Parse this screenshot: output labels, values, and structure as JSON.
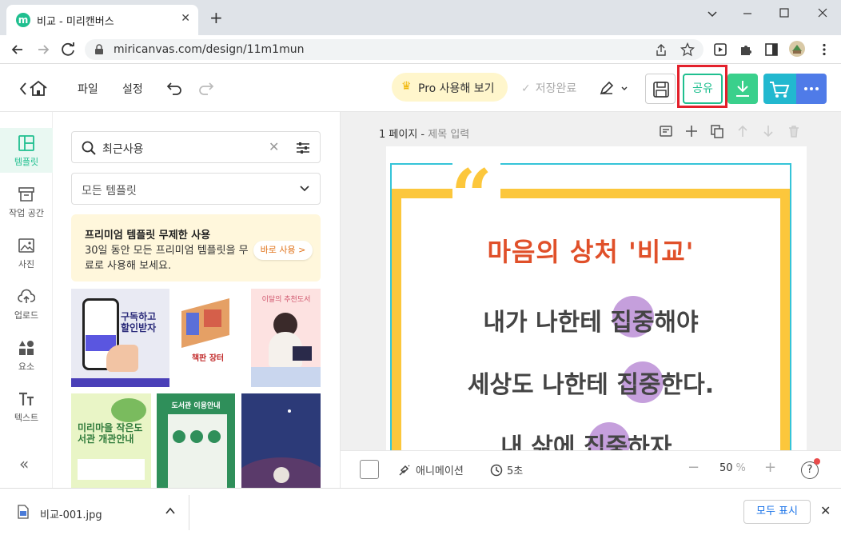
{
  "browser": {
    "tab_title": "비교 - 미리캔버스",
    "tab_favicon_letter": "m",
    "url": "miricanvas.com/design/11m1mun",
    "new_tab": "+",
    "tab_close": "✕"
  },
  "header": {
    "menu_file": "파일",
    "menu_settings": "설정",
    "pro_label": "Pro 사용해 보기",
    "saved_status": "저장완료",
    "share_label": "공유"
  },
  "leftnav": {
    "items": [
      {
        "label": "템플릿"
      },
      {
        "label": "작업 공간"
      },
      {
        "label": "사진"
      },
      {
        "label": "업로드"
      },
      {
        "label": "요소"
      },
      {
        "label": "텍스트"
      }
    ],
    "collapse": "«"
  },
  "panel": {
    "search_value": "최근사용",
    "category": "모든 템플릿",
    "promo_title": "프리미엄 템플릿 무제한 사용",
    "promo_desc": "30일 동안 모든 프리미엄 템플릿을 무료로 사용해 보세요.",
    "promo_button": "바로 사용 >",
    "thumb_texts": {
      "t1": "구독하고 할인받자",
      "t2": "책판 장터",
      "t3": "이달의 추천도서",
      "t4": "미리마을 작은도서관 개관안내",
      "t5": "도서관 이용안내"
    }
  },
  "canvas": {
    "page_label": "1 페이지",
    "page_title_placeholder": "제목 입력",
    "quote_mark": "“",
    "heading": "마음의 상처 '비교'",
    "lines": [
      "내가 나한테 집중해야",
      "세상도 나한테 집중한다.",
      "내 삶에 집중하자."
    ],
    "animation_label": "애니메이션",
    "duration": "5초",
    "zoom": "50",
    "zoom_unit": "%",
    "help": "?"
  },
  "downloads": {
    "file_name": "비교-001.jpg",
    "show_all": "모두 표시"
  },
  "colors": {
    "brand": "#1fbf8f",
    "accent_yellow": "#fcc73c",
    "heading_red": "#e0502a",
    "highlight_purple": "#b27fd0",
    "selection_cyan": "#35c4d8",
    "annotation_red": "#e3202b"
  }
}
